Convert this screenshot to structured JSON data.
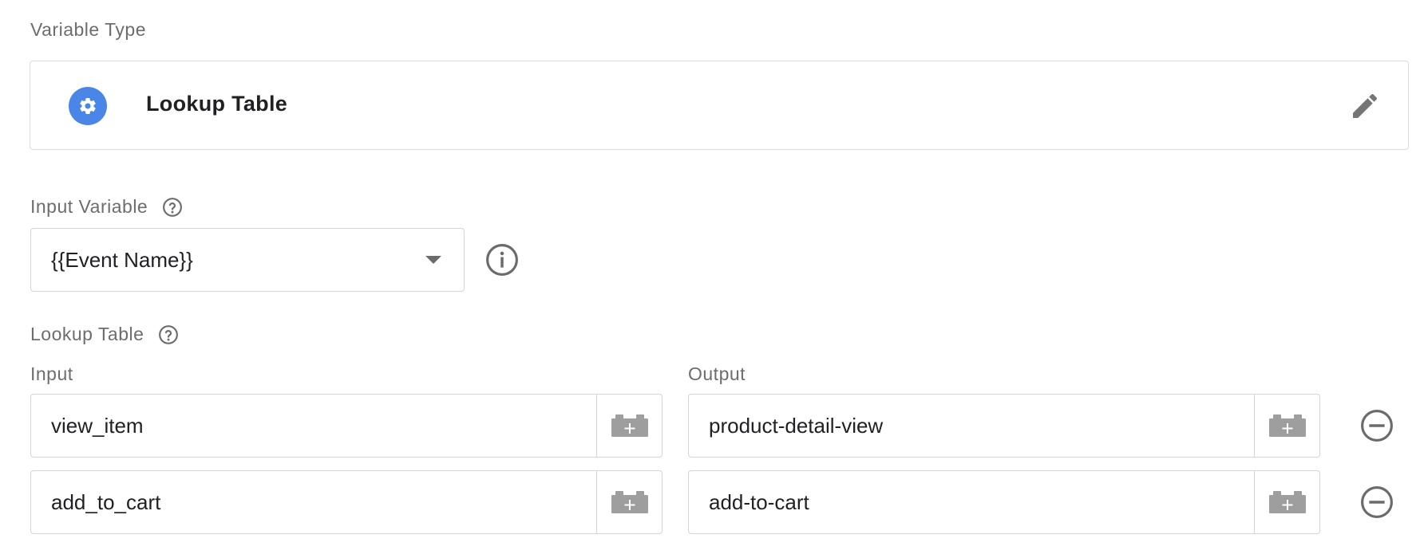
{
  "variable_type": {
    "section_label": "Variable Type",
    "name": "Lookup Table",
    "icon": "gear-icon",
    "edit_icon": "pencil-icon",
    "accent_color": "#4a86e8"
  },
  "input_variable": {
    "section_label": "Input Variable",
    "selected_value": "{{Event Name}}",
    "info_icon": "info-icon"
  },
  "lookup_table": {
    "section_label": "Lookup Table",
    "input_header": "Input",
    "output_header": "Output",
    "rows": [
      {
        "input": "view_item",
        "output": "product-detail-view"
      },
      {
        "input": "add_to_cart",
        "output": "add-to-cart"
      }
    ]
  }
}
